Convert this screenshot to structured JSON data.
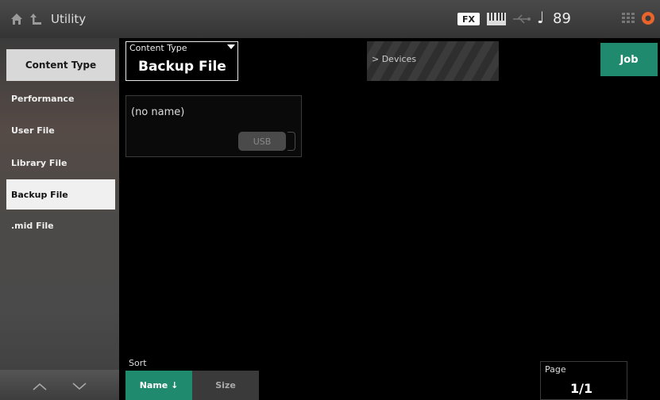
{
  "header": {
    "title": "Utility",
    "fx_badge": "FX",
    "tempo": "89",
    "tempo_icon": "♩",
    "icons": [
      "home-icon",
      "up-arrow-icon",
      "keyboard-icon",
      "usb-icon",
      "grid-icon",
      "gear-icon"
    ],
    "gear_color": "#e8642a"
  },
  "sidebar": {
    "header": "Content Type",
    "items": [
      {
        "label": "Performance",
        "selected": false
      },
      {
        "label": "User File",
        "selected": false
      },
      {
        "label": "Library File",
        "selected": false
      },
      {
        "label": "Backup File",
        "selected": true
      },
      {
        "label": ".mid File",
        "selected": false
      }
    ]
  },
  "content_type": {
    "label": "Content Type",
    "value": "Backup File"
  },
  "devices_label": "> Devices",
  "job_label": "Job",
  "file_card": {
    "name": "(no name)",
    "tag": "USB"
  },
  "sort": {
    "label": "Sort",
    "options": [
      "Name ↓",
      "Size"
    ],
    "active": "Name"
  },
  "page": {
    "label": "Page",
    "value": "1/1"
  },
  "colors": {
    "accent": "#1f8a6e",
    "selected_bg": "#f0f0f0"
  }
}
